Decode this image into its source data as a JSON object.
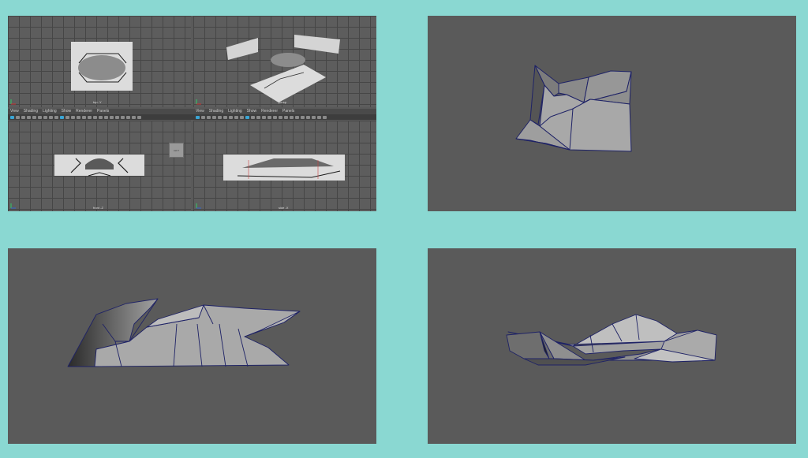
{
  "viewports": {
    "top": {
      "label": "top -Y"
    },
    "persp": {
      "label": "persp"
    },
    "front": {
      "label": "front -Z"
    },
    "side": {
      "label": "side -X"
    }
  },
  "menu": {
    "items": [
      "View",
      "Shading",
      "Lighting",
      "Show",
      "Renderer",
      "Panels"
    ]
  },
  "camera_cube": {
    "label": "LEFT"
  },
  "colors": {
    "background": "#8ad8d2",
    "viewport_bg": "#5a5a5a",
    "mesh_fill": "#a7a7a7",
    "wire": "#1e2266",
    "toolbar_accent": "#3aa5d4"
  },
  "icons": [
    "axis-gizmo-icon",
    "toolbar-icons"
  ]
}
